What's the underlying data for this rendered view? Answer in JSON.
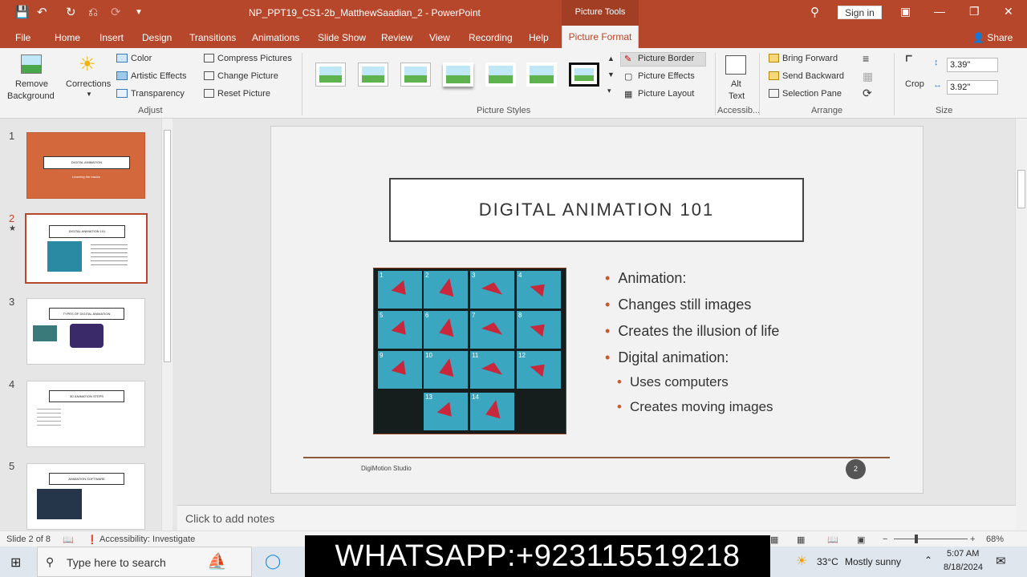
{
  "window": {
    "title": "NP_PPT19_CS1-2b_MatthewSaadian_2  -  PowerPoint",
    "tools_label": "Picture Tools",
    "sign_in": "Sign in"
  },
  "tabs": [
    "File",
    "Home",
    "Insert",
    "Design",
    "Transitions",
    "Animations",
    "Slide Show",
    "Review",
    "View",
    "Recording",
    "Help"
  ],
  "active_tab": "Picture Format",
  "share": "Share",
  "ribbon": {
    "adjust": {
      "remove_bg_1": "Remove",
      "remove_bg_2": "Background",
      "corrections": "Corrections",
      "color": "Color",
      "artistic": "Artistic Effects",
      "transparency": "Transparency",
      "compress": "Compress Pictures",
      "change": "Change Picture",
      "reset": "Reset Picture",
      "group": "Adjust"
    },
    "styles": {
      "border": "Picture Border",
      "effects": "Picture Effects",
      "layout": "Picture Layout",
      "group": "Picture Styles"
    },
    "access": {
      "alt1": "Alt",
      "alt2": "Text",
      "group": "Accessib..."
    },
    "arrange": {
      "forward": "Bring Forward",
      "backward": "Send Backward",
      "pane": "Selection Pane",
      "group": "Arrange"
    },
    "size": {
      "crop": "Crop",
      "height": "3.39\"",
      "width": "3.92\"",
      "group": "Size"
    }
  },
  "thumbnails": [
    {
      "num": "1",
      "title": "DIGITAL ANIMATION",
      "subtitle": "Learning the basics"
    },
    {
      "num": "2",
      "title": "DIGITAL ANIMATION 101"
    },
    {
      "num": "3",
      "title": "TYPES OF DIGITAL ANIMATION"
    },
    {
      "num": "4",
      "title": "3D ANIMATION STEPS"
    },
    {
      "num": "5",
      "title": "ANIMATION SOFTWARE"
    }
  ],
  "slide": {
    "title": "DIGITAL ANIMATION 101",
    "bullets": [
      {
        "text": "Animation:",
        "level": 1
      },
      {
        "text": "Changes still images",
        "level": 1
      },
      {
        "text": "Creates the illusion of life",
        "level": 1
      },
      {
        "text": "Digital animation:",
        "level": 1
      },
      {
        "text": "Uses computers",
        "level": 2
      },
      {
        "text": "Creates moving images",
        "level": 2
      }
    ],
    "frames": [
      "1",
      "2",
      "3",
      "4",
      "5",
      "6",
      "7",
      "8",
      "9",
      "10",
      "11",
      "12",
      "13",
      "14"
    ],
    "footer": "DigiMotion Studio",
    "page": "2"
  },
  "notes_placeholder": "Click to add notes",
  "status": {
    "slide_of": "Slide 2 of 8",
    "accessibility": "Accessibility: Investigate",
    "zoom": "68%"
  },
  "taskbar": {
    "search": "Type here to search",
    "overlay": "WHATSAPP:+923115519218",
    "temp": "33°C",
    "weather": "Mostly sunny",
    "time": "5:07 AM",
    "date": "8/18/2024"
  },
  "colors": {
    "accent": "#b7472a",
    "tile": "#3ba6c0",
    "butterfly": "#c8283c"
  }
}
